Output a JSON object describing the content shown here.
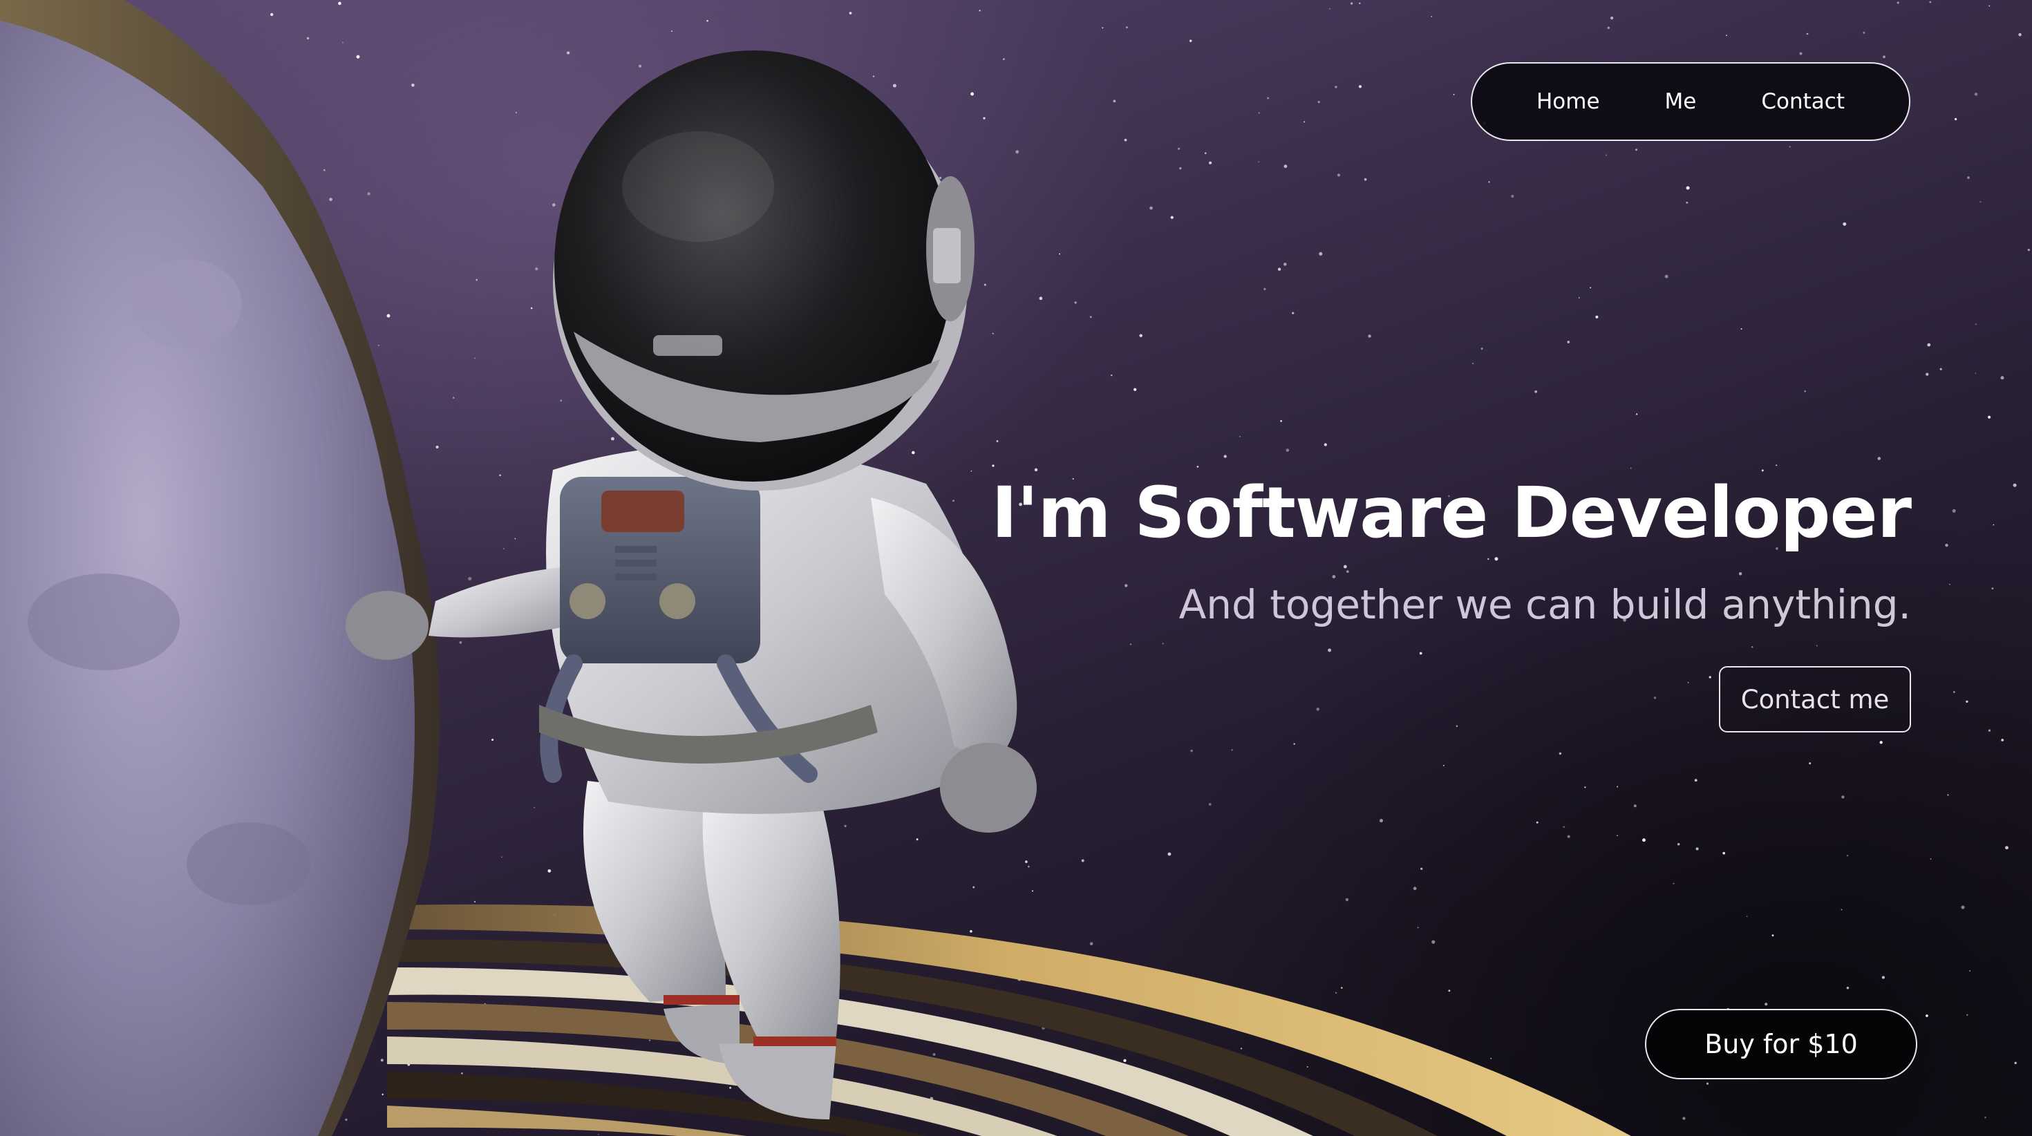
{
  "nav": {
    "items": [
      {
        "label": "Home"
      },
      {
        "label": "Me"
      },
      {
        "label": "Contact"
      }
    ]
  },
  "hero": {
    "title": "I'm Software Developer",
    "subtitle": "And together we can build anything.",
    "contact_label": "Contact me"
  },
  "buy": {
    "label": "Buy for $10"
  },
  "scene": {
    "icon": "astronaut-illustration",
    "colors": {
      "sky_top": "#5a4870",
      "sky_bottom": "#17121d",
      "asteroid": "#8c84a8",
      "ring_gold": "#c9a45e",
      "suit": "#d6d6da",
      "helmet_visor": "#141416"
    }
  }
}
